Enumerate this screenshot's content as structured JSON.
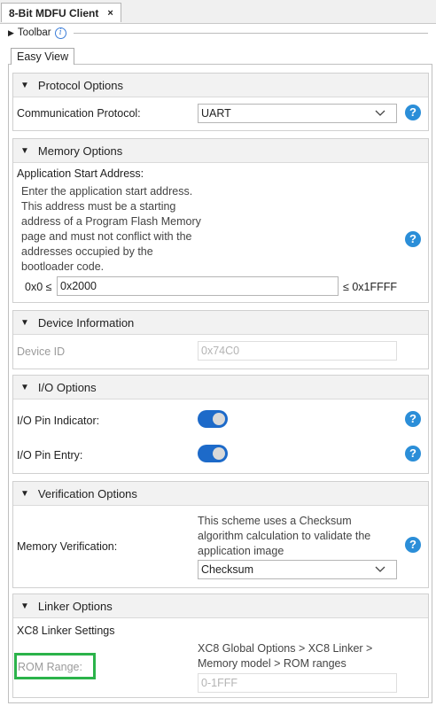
{
  "editor_tab": {
    "title": "8-Bit MDFU Client",
    "close": "×"
  },
  "toolbar": {
    "label": "Toolbar",
    "info": "i"
  },
  "view_tab": {
    "label": "Easy View"
  },
  "help_glyph": "?",
  "protocol": {
    "header": "Protocol Options",
    "comm_label": "Communication Protocol:",
    "comm_value": "UART"
  },
  "memory": {
    "header": "Memory Options",
    "start_label": "Application Start Address:",
    "desc_lines": [
      "Enter the application start address.",
      "This address must be a starting",
      "address of a Program Flash Memory",
      "page and must not conflict with the",
      "addresses occupied by the",
      "bootloader code."
    ],
    "min_label": "0x0 ≤",
    "address_value": "0x2000",
    "max_label": "≤ 0x1FFFF"
  },
  "device": {
    "header": "Device Information",
    "id_label": "Device ID",
    "id_value": "0x74C0"
  },
  "io": {
    "header": "I/O Options",
    "indicator_label": "I/O Pin Indicator:",
    "entry_label": "I/O Pin Entry:",
    "indicator_on": true,
    "entry_on": true
  },
  "verification": {
    "header": "Verification Options",
    "label": "Memory Verification:",
    "desc_lines": [
      "This scheme uses a Checksum",
      "algorithm calculation to validate the",
      "application image"
    ],
    "value": "Checksum"
  },
  "linker": {
    "header": "Linker Options",
    "settings_label": "XC8 Linker Settings",
    "rom_label": "ROM Range:",
    "desc_lines": [
      "XC8 Global Options > XC8 Linker >",
      "Memory model > ROM ranges"
    ],
    "rom_value": "0-1FFF"
  },
  "colors": {
    "accent": "#2b8ed8",
    "toggle_on": "#1d6ac9",
    "highlight": "#2bb34a"
  }
}
